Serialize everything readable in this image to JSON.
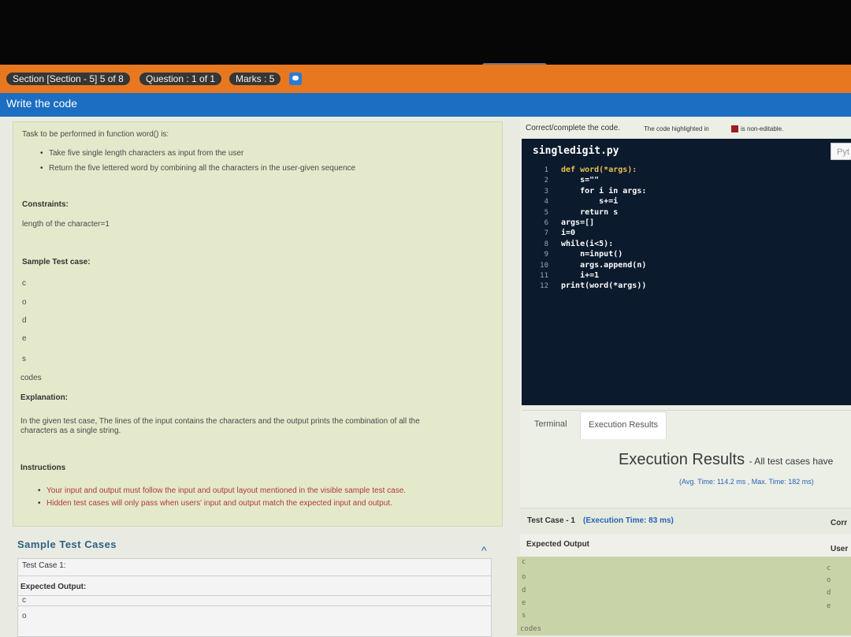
{
  "header": {
    "section": "Section [Section - 5] 5 of 8",
    "question": "Question : 1 of 1",
    "marks": "Marks : 5",
    "chat_icon": "chat-icon",
    "subtitle": "Write the code"
  },
  "problem": {
    "task": "Task to be performed in function word() is:",
    "bullets": [
      "Take five single length characters as input from the user",
      "Return the five lettered word by combining all the characters in the user-given sequence"
    ],
    "constraints_label": "Constraints:",
    "constraints_text": "length of the character=1",
    "sample_label": "Sample Test case:",
    "sample_lines": [
      "c",
      "o",
      "d",
      "e",
      "s",
      "codes"
    ],
    "explanation_label": "Explanation:",
    "explanation_line1": "In the given test case, The lines of the input contains the characters and the output prints the combination of all the",
    "explanation_line2": "characters as a single string.",
    "instructions_label": "Instructions",
    "instructions": [
      "Your input and output must follow the input and output layout mentioned in the visible sample test case.",
      "Hidden test cases will only pass when users' input and output match the expected input and output."
    ]
  },
  "sample_cases": {
    "title": "Sample Test Cases",
    "case_label": "Test Case 1:",
    "expected_label": "Expected Output:",
    "lines": [
      "c",
      "o"
    ]
  },
  "editor": {
    "instruction": "Correct/complete the code.",
    "note": "The code highlighted in",
    "note_end": "is non-editable.",
    "filename": "singledigit.py",
    "language": "Pyt",
    "lines": [
      {
        "n": "1",
        "code": "def word(*args):"
      },
      {
        "n": "2",
        "code": "    s=\"\""
      },
      {
        "n": "3",
        "code": "    for i in args:"
      },
      {
        "n": "4",
        "code": "        s+=i"
      },
      {
        "n": "5",
        "code": "    return s"
      },
      {
        "n": "6",
        "code": "args=[]"
      },
      {
        "n": "7",
        "code": "i=0"
      },
      {
        "n": "8",
        "code": "while(i<5):"
      },
      {
        "n": "9",
        "code": "    n=input()"
      },
      {
        "n": "10",
        "code": "    args.append(n)"
      },
      {
        "n": "11",
        "code": "    i+=1"
      },
      {
        "n": "12",
        "code": "print(word(*args))"
      }
    ]
  },
  "results": {
    "tabs": [
      "Terminal",
      "Execution Results"
    ],
    "active_tab": "Execution Results",
    "title": "Execution Results",
    "title_suffix": "- All test cases have",
    "times": "(Avg. Time: 114.2 ms , Max. Time: 182 ms)",
    "case": "Test Case - 1",
    "case_time": "(Execution Time: 83 ms)",
    "right_label": "Corr",
    "expected_label": "Expected Output",
    "user_label": "User",
    "expected_lines": [
      "c",
      "o",
      "d",
      "e",
      "s",
      "codes"
    ],
    "user_lines": [
      "c",
      "o",
      "d",
      "e"
    ]
  }
}
